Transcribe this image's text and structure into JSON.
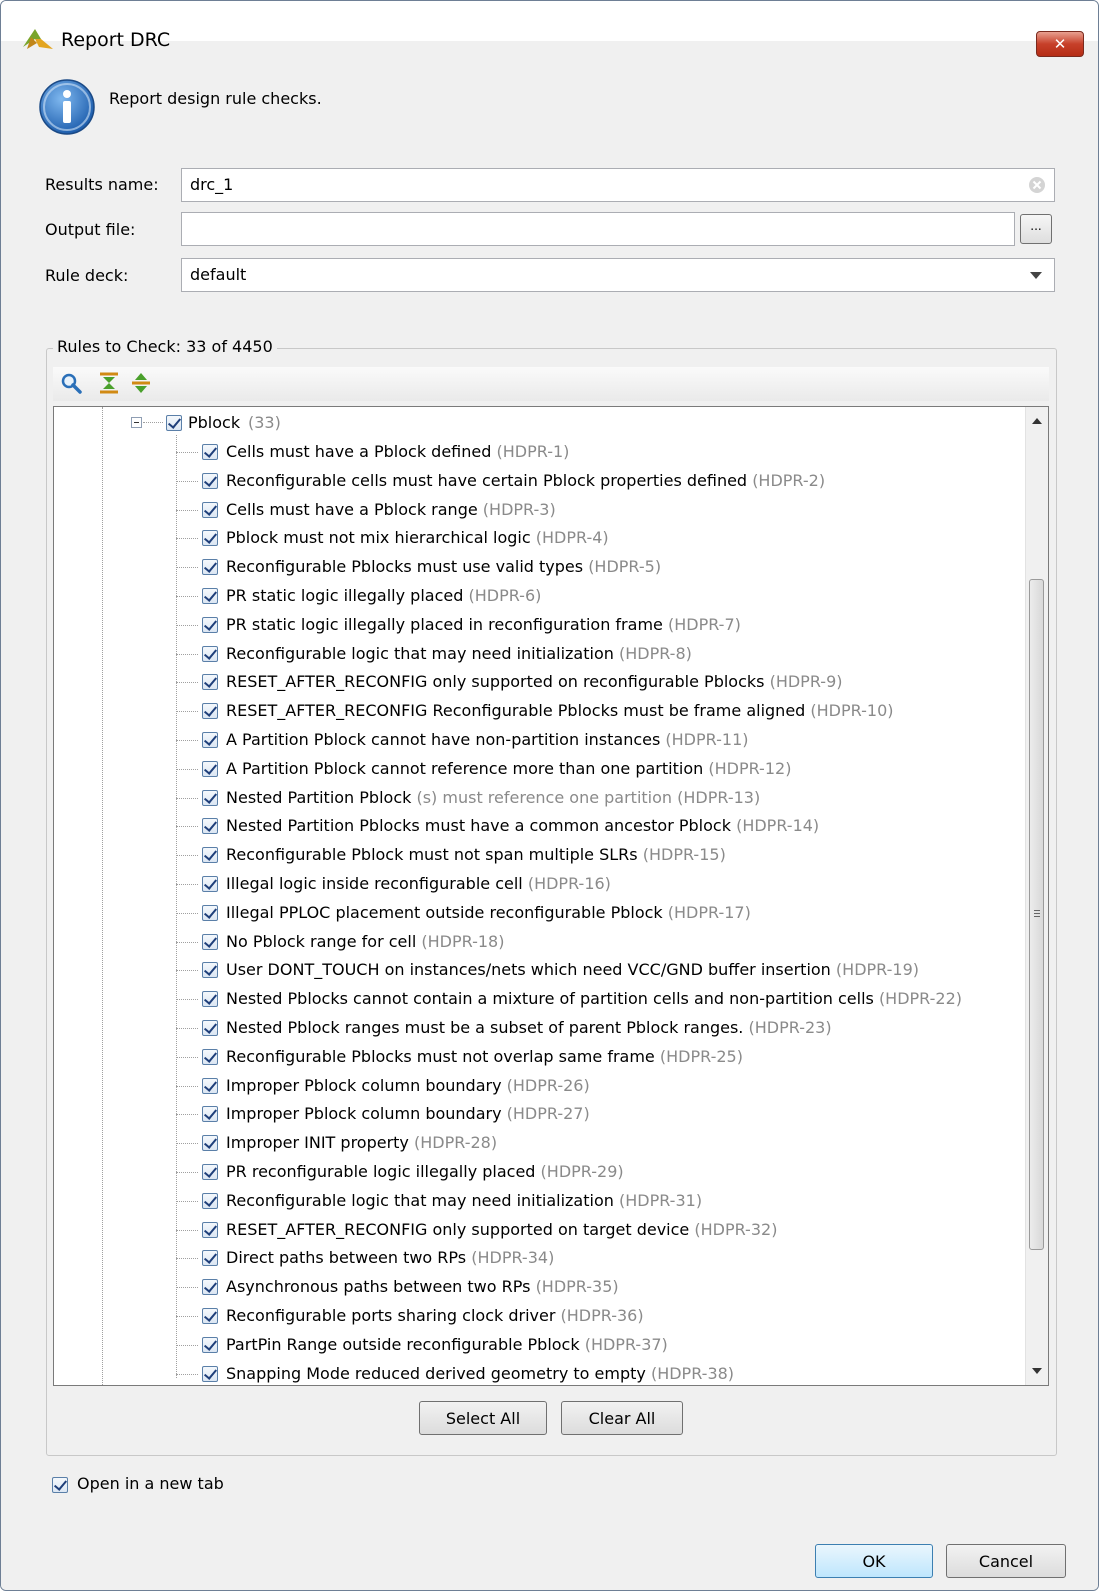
{
  "window": {
    "title": "Report DRC",
    "close_label": "✕"
  },
  "description": "Report design rule checks.",
  "form": {
    "results_name_label": "Results name:",
    "results_name_value": "drc_1",
    "output_file_label": "Output file:",
    "output_file_value": "",
    "browse_label": "...",
    "rule_deck_label": "Rule deck:",
    "rule_deck_value": "default"
  },
  "rules": {
    "legend": "Rules to Check: 33 of 4450",
    "toolbar_icons": [
      "search-icon",
      "collapse-all-icon",
      "expand-all-icon"
    ],
    "group": {
      "label": "Pblock",
      "count": "(33)",
      "checked": true
    },
    "items": [
      {
        "label": "Cells must have a Pblock defined",
        "code": "(HDPR-1)",
        "checked": true
      },
      {
        "label": "Reconfigurable cells must have certain Pblock properties defined",
        "code": "(HDPR-2)",
        "checked": true
      },
      {
        "label": "Cells must have a Pblock range",
        "code": "(HDPR-3)",
        "checked": true
      },
      {
        "label": "Pblock must not mix hierarchical logic",
        "code": "(HDPR-4)",
        "checked": true
      },
      {
        "label": "Reconfigurable Pblocks must use valid types",
        "code": "(HDPR-5)",
        "checked": true
      },
      {
        "label": "PR static logic illegally placed",
        "code": "(HDPR-6)",
        "checked": true
      },
      {
        "label": "PR static logic illegally placed in reconfiguration frame",
        "code": "(HDPR-7)",
        "checked": true
      },
      {
        "label": "Reconfigurable logic that may need initialization",
        "code": "(HDPR-8)",
        "checked": true
      },
      {
        "label": "RESET_AFTER_RECONFIG only supported on reconfigurable Pblocks",
        "code": "(HDPR-9)",
        "checked": true
      },
      {
        "label": "RESET_AFTER_RECONFIG Reconfigurable Pblocks must be frame aligned",
        "code": "(HDPR-10)",
        "checked": true
      },
      {
        "label": "A Partition Pblock cannot have non-partition instances",
        "code": "(HDPR-11)",
        "checked": true
      },
      {
        "label": "A Partition Pblock cannot reference more than one partition",
        "code": "(HDPR-12)",
        "checked": true
      },
      {
        "label": "Nested Partition Pblock",
        "code": "(s) must reference one partition (HDPR-13)",
        "checked": true
      },
      {
        "label": "Nested Partition Pblocks must have a common ancestor Pblock",
        "code": "(HDPR-14)",
        "checked": true
      },
      {
        "label": "Reconfigurable Pblock must not span multiple SLRs",
        "code": "(HDPR-15)",
        "checked": true
      },
      {
        "label": "Illegal logic inside reconfigurable cell",
        "code": "(HDPR-16)",
        "checked": true
      },
      {
        "label": "Illegal PPLOC placement outside reconfigurable Pblock",
        "code": "(HDPR-17)",
        "checked": true
      },
      {
        "label": "No Pblock range for cell",
        "code": "(HDPR-18)",
        "checked": true
      },
      {
        "label": "User DONT_TOUCH on instances/nets which need VCC/GND buffer insertion",
        "code": "(HDPR-19)",
        "checked": true
      },
      {
        "label": "Nested Pblocks cannot contain a mixture of partition cells and non-partition cells",
        "code": "(HDPR-22)",
        "checked": true
      },
      {
        "label": "Nested Pblock ranges must be a subset of parent Pblock ranges.",
        "code": "(HDPR-23)",
        "checked": true
      },
      {
        "label": "Reconfigurable Pblocks must not overlap same frame",
        "code": "(HDPR-25)",
        "checked": true
      },
      {
        "label": "Improper Pblock column boundary",
        "code": "(HDPR-26)",
        "checked": true
      },
      {
        "label": "Improper Pblock column boundary",
        "code": "(HDPR-27)",
        "checked": true
      },
      {
        "label": "Improper INIT property",
        "code": "(HDPR-28)",
        "checked": true
      },
      {
        "label": "PR reconfigurable logic illegally placed",
        "code": "(HDPR-29)",
        "checked": true
      },
      {
        "label": "Reconfigurable logic that may need initialization",
        "code": "(HDPR-31)",
        "checked": true
      },
      {
        "label": "RESET_AFTER_RECONFIG only supported on target device",
        "code": "(HDPR-32)",
        "checked": true
      },
      {
        "label": "Direct paths between two RPs",
        "code": "(HDPR-34)",
        "checked": true
      },
      {
        "label": "Asynchronous paths between two RPs",
        "code": "(HDPR-35)",
        "checked": true
      },
      {
        "label": "Reconfigurable ports sharing clock driver",
        "code": "(HDPR-36)",
        "checked": true
      },
      {
        "label": "PartPin Range outside reconfigurable Pblock",
        "code": "(HDPR-37)",
        "checked": true
      },
      {
        "label": "Snapping Mode reduced derived geometry to empty",
        "code": "(HDPR-38)",
        "checked": true
      }
    ],
    "select_all_label": "Select All",
    "clear_all_label": "Clear All"
  },
  "open_in_new_tab": {
    "label": "Open in a new tab",
    "checked": true
  },
  "buttons": {
    "ok_label": "OK",
    "cancel_label": "Cancel"
  },
  "colors": {
    "code_gray": "#8a8a8a",
    "close_red": "#c7402a",
    "info_blue": "#2a6fb8"
  }
}
